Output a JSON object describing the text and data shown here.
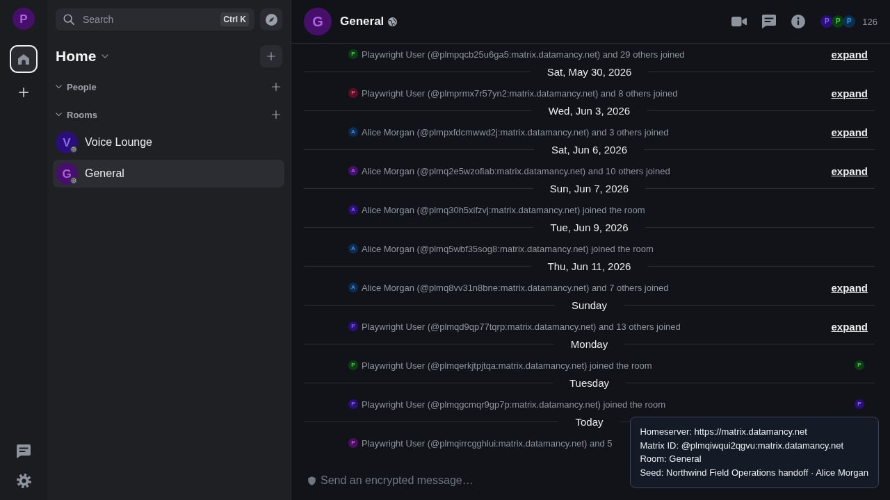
{
  "space_bar": {
    "account": {
      "letter": "P",
      "color": "#46106a"
    },
    "spaces": [
      {
        "kind": "home",
        "selected": true
      }
    ]
  },
  "room_list": {
    "search": {
      "placeholder": "Search",
      "shortcut": "Ctrl K"
    },
    "title": "Home",
    "sections": [
      {
        "label": "People",
        "expanded": true
      },
      {
        "label": "Rooms",
        "expanded": true,
        "rooms": [
          {
            "name": "Voice Lounge",
            "letter": "V",
            "color": "#2a0f7a",
            "public": true,
            "selected": false
          },
          {
            "name": "General",
            "letter": "G",
            "color": "#46106a",
            "public": true,
            "selected": true
          }
        ]
      }
    ]
  },
  "room_header": {
    "letter": "G",
    "color": "#46106a",
    "name": "General",
    "public": true,
    "members": [
      {
        "letter": "P",
        "color": "#2a0f7a"
      },
      {
        "letter": "P",
        "color": "#0d3b12"
      },
      {
        "letter": "P",
        "color": "#0a3050"
      }
    ],
    "member_count": "126"
  },
  "timeline": {
    "items": [
      {
        "kind": "event",
        "letter": "P",
        "color": "#0d3b12",
        "text": "Playwright User (@plmpqcb25u6ga5:matrix.datamancy.net) and 29 others joined",
        "expand": "expand"
      },
      {
        "kind": "date",
        "label": "Sat, May 30, 2026"
      },
      {
        "kind": "event",
        "letter": "P",
        "color": "#5a0f25",
        "text": "Playwright User (@plmprmx7r57yn2:matrix.datamancy.net) and 8 others joined",
        "expand": "expand"
      },
      {
        "kind": "date",
        "label": "Wed, Jun 3, 2026"
      },
      {
        "kind": "event",
        "letter": "A",
        "color": "#0c2c52",
        "text": "Alice Morgan (@plmpxfdcmwwd2j:matrix.datamancy.net) and 3 others joined",
        "expand": "expand"
      },
      {
        "kind": "date",
        "label": "Sat, Jun 6, 2026"
      },
      {
        "kind": "event",
        "letter": "A",
        "color": "#46106a",
        "text": "Alice Morgan (@plmq2e5wzofiab:matrix.datamancy.net) and 10 others joined",
        "expand": "expand"
      },
      {
        "kind": "date",
        "label": "Sun, Jun 7, 2026"
      },
      {
        "kind": "event",
        "letter": "A",
        "color": "#2a0f7a",
        "text": "Alice Morgan (@plmq30h5xifzvj:matrix.datamancy.net) joined the room"
      },
      {
        "kind": "date",
        "label": "Tue, Jun 9, 2026"
      },
      {
        "kind": "event",
        "letter": "A",
        "color": "#0c2c52",
        "text": "Alice Morgan (@plmq5wbf35sog8:matrix.datamancy.net) joined the room"
      },
      {
        "kind": "date",
        "label": "Thu, Jun 11, 2026"
      },
      {
        "kind": "event",
        "letter": "A",
        "color": "#0c2c52",
        "text": "Alice Morgan (@plmq8vv31n8bne:matrix.datamancy.net) and 7 others joined",
        "expand": "expand"
      },
      {
        "kind": "date",
        "label": "Sunday"
      },
      {
        "kind": "event",
        "letter": "P",
        "color": "#2a0f7a",
        "text": "Playwright User (@plmqd9qp77tqrp:matrix.datamancy.net) and 13 others joined",
        "expand": "expand"
      },
      {
        "kind": "date",
        "label": "Monday"
      },
      {
        "kind": "event",
        "letter": "P",
        "color": "#0d3b12",
        "text": "Playwright User (@plmqerkjtpjtqa:matrix.datamancy.net) joined the room",
        "receipt": {
          "letter": "P",
          "color": "#0d3b12"
        }
      },
      {
        "kind": "date",
        "label": "Tuesday"
      },
      {
        "kind": "event",
        "letter": "P",
        "color": "#2a0f7a",
        "text": "Playwright User (@plmqgcmqr9gp7p:matrix.datamancy.net) joined the room",
        "receipt": {
          "letter": "P",
          "color": "#2a0f7a"
        }
      },
      {
        "kind": "date",
        "label": "Today"
      },
      {
        "kind": "event",
        "letter": "P",
        "color": "#4a0f5e",
        "text": "Playwright User (@plmqirrcgghlui:matrix.datamancy.net) and 5"
      }
    ]
  },
  "composer": {
    "placeholder": "Send an encrypted message…"
  },
  "tooltip": {
    "lines": [
      "Homeserver: https://matrix.datamancy.net",
      "Matrix ID: @plmqiwqui2qgvu:matrix.datamancy.net",
      "Room: General",
      "Seed: Northwind Field Operations handoff · Alice Morgan"
    ]
  }
}
